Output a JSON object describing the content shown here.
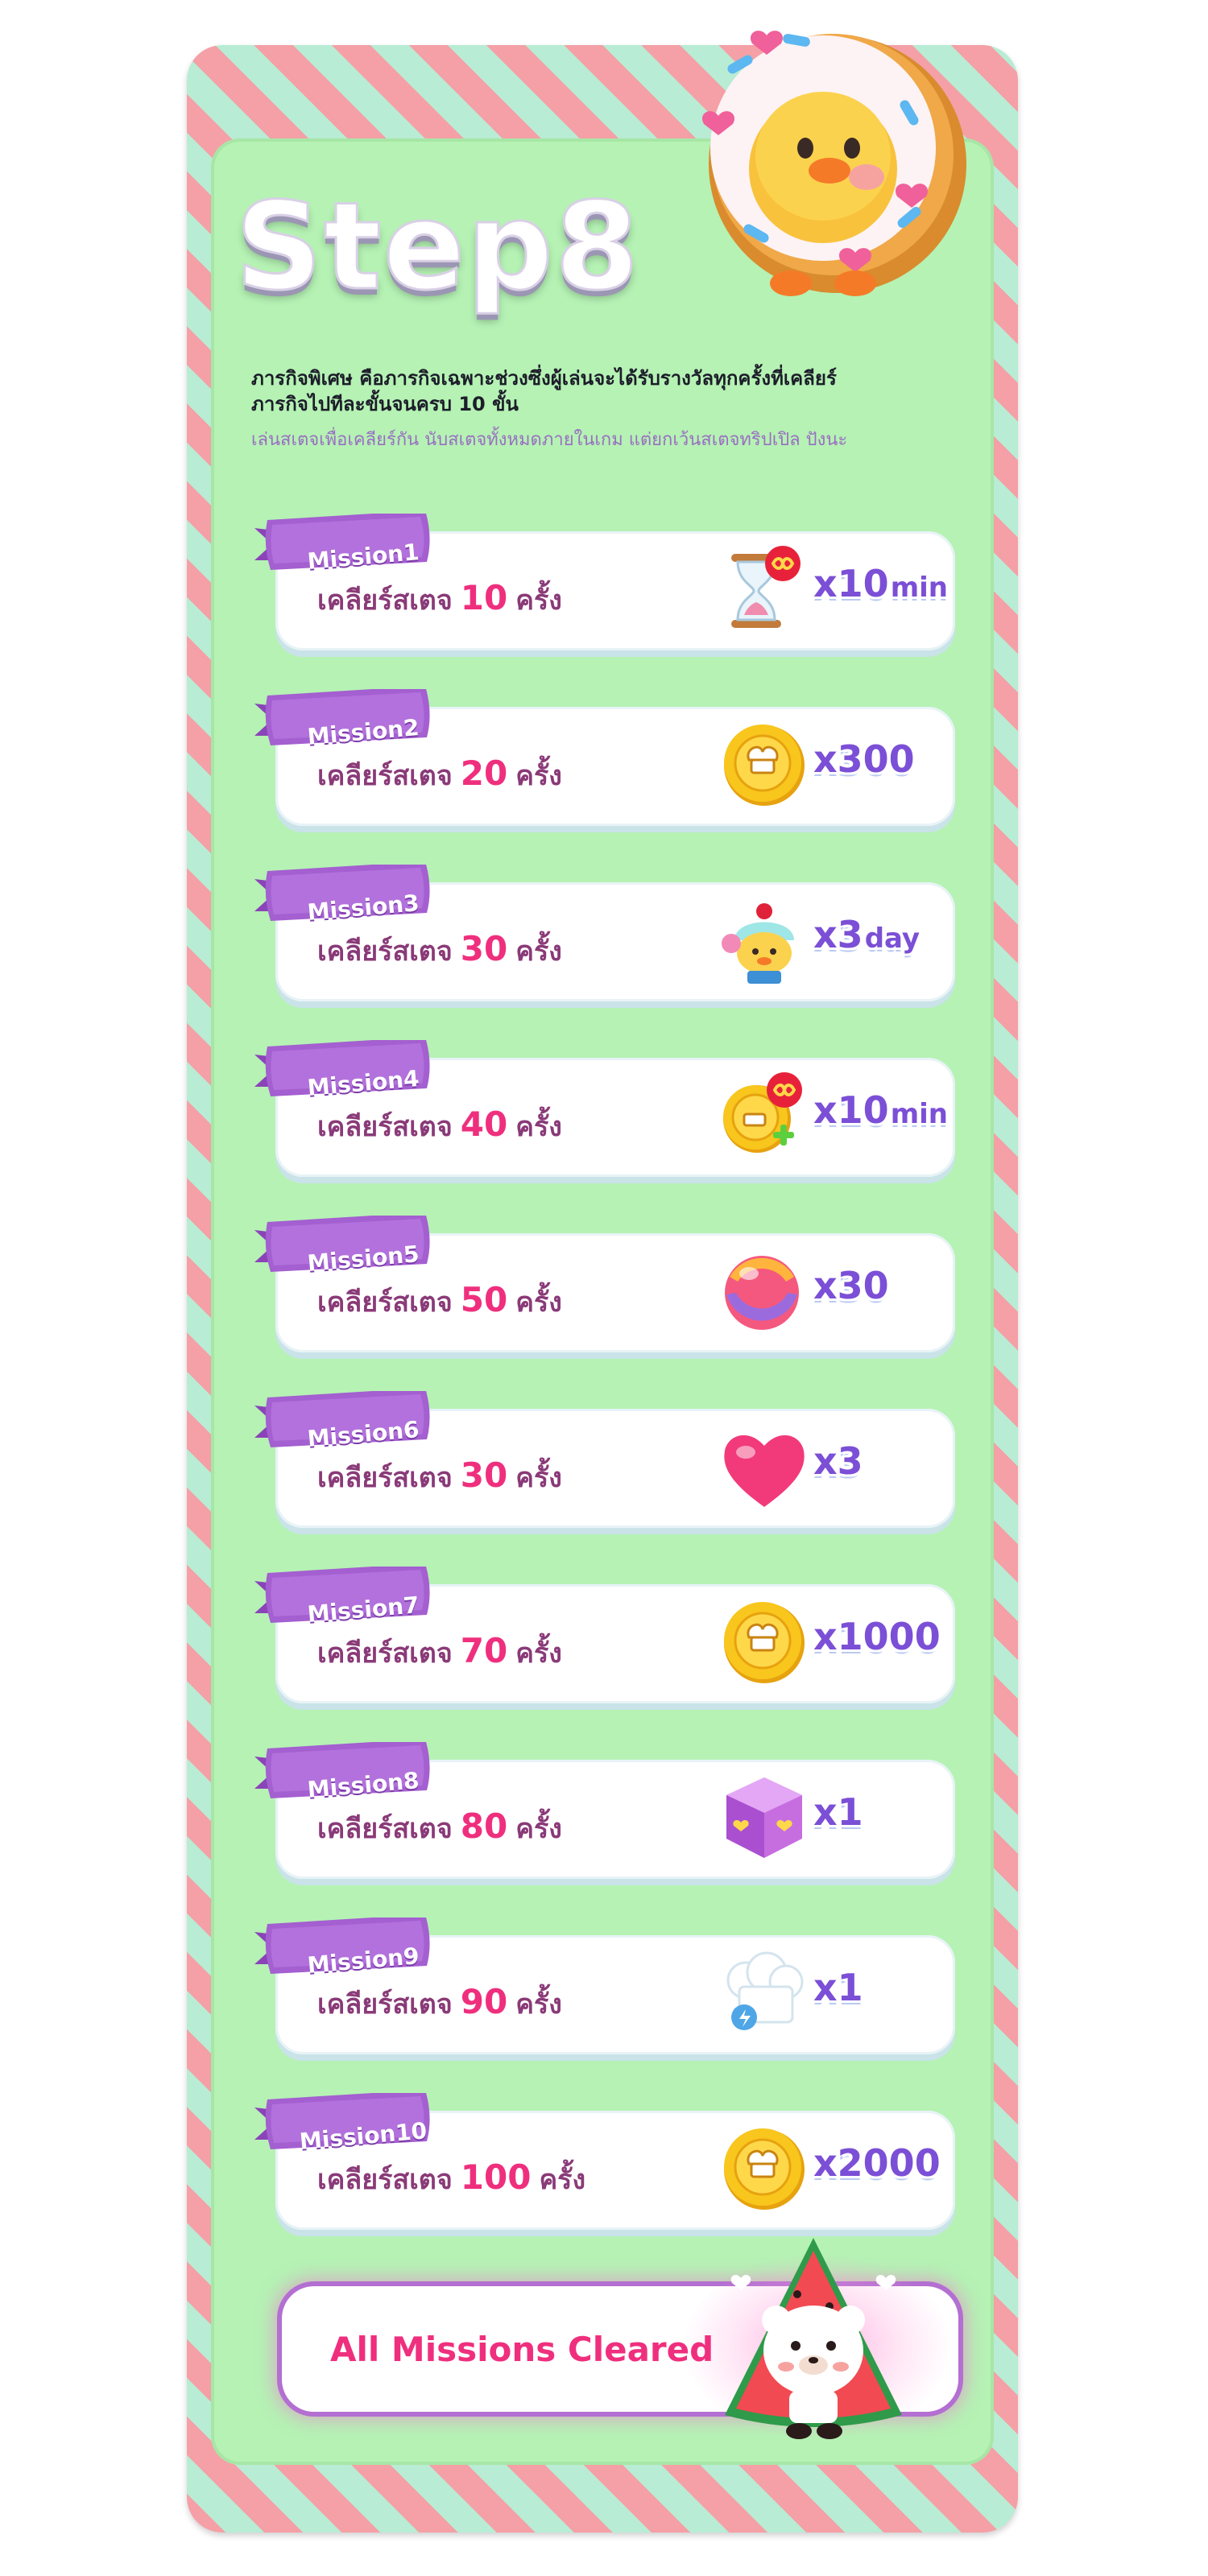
{
  "page": {
    "title": "Step8",
    "description": "ภารกิจพิเศษ คือภารกิจเฉพาะช่วงซึ่งผู้เล่นจะได้รับรางวัลทุกครั้งที่เคลียร์ ภารกิจไปทีละขั้นจนครบ 10 ขั้น",
    "note": "เล่นสเตจเพื่อเคลียร์กัน นับสเตจทั้งหมดภายในเกม แต่ยกเว้นสเตจทริปเปิล ปังนะ"
  },
  "colors": {
    "stripe_red": "#f4a0a6",
    "stripe_mint": "#b8ecd4",
    "panel_green": "#b5f2b4",
    "ribbon_purple": "#a45fd0",
    "count_pink": "#ef2f7e",
    "reward_purple": "#7b4fd6"
  },
  "missions": [
    {
      "label": "Mission1",
      "prefix": "เคลียร์สเตจ",
      "count": "10",
      "suffix": "ครั้ง",
      "reward_icon": "infinite-time-hourglass-icon",
      "reward_amount": "x10",
      "reward_unit": "min"
    },
    {
      "label": "Mission2",
      "prefix": "เคลียร์สเตจ",
      "count": "20",
      "suffix": "ครั้ง",
      "reward_icon": "gold-coin-icon",
      "reward_amount": "x300",
      "reward_unit": ""
    },
    {
      "label": "Mission3",
      "prefix": "เคลียร์สเตจ",
      "count": "30",
      "suffix": "ครั้ง",
      "reward_icon": "cupcake-character-icon",
      "reward_amount": "x3",
      "reward_unit": "day"
    },
    {
      "label": "Mission4",
      "prefix": "เคลียร์สเตจ",
      "count": "40",
      "suffix": "ครั้ง",
      "reward_icon": "infinite-coin-boost-icon",
      "reward_amount": "x10",
      "reward_unit": "min"
    },
    {
      "label": "Mission5",
      "prefix": "เคลียร์สเตจ",
      "count": "50",
      "suffix": "ครั้ง",
      "reward_icon": "candy-ball-icon",
      "reward_amount": "x30",
      "reward_unit": ""
    },
    {
      "label": "Mission6",
      "prefix": "เคลียร์สเตจ",
      "count": "30",
      "suffix": "ครั้ง",
      "reward_icon": "heart-icon",
      "reward_amount": "x3",
      "reward_unit": ""
    },
    {
      "label": "Mission7",
      "prefix": "เคลียร์สเตจ",
      "count": "70",
      "suffix": "ครั้ง",
      "reward_icon": "gold-coin-icon",
      "reward_amount": "x1000",
      "reward_unit": ""
    },
    {
      "label": "Mission8",
      "prefix": "เคลียร์สเตจ",
      "count": "80",
      "suffix": "ครั้ง",
      "reward_icon": "mystery-box-icon",
      "reward_amount": "x1",
      "reward_unit": ""
    },
    {
      "label": "Mission9",
      "prefix": "เคลียร์สเตจ",
      "count": "90",
      "suffix": "ครั้ง",
      "reward_icon": "chef-hat-icon",
      "reward_amount": "x1",
      "reward_unit": ""
    },
    {
      "label": "Mission10",
      "prefix": "เคลียร์สเตจ",
      "count": "100",
      "suffix": "ครั้ง",
      "reward_icon": "gold-coin-icon",
      "reward_amount": "x2000",
      "reward_unit": ""
    }
  ],
  "final": {
    "label": "All Missions Cleared",
    "reward_icon": "watermelon-bear-character-icon"
  }
}
